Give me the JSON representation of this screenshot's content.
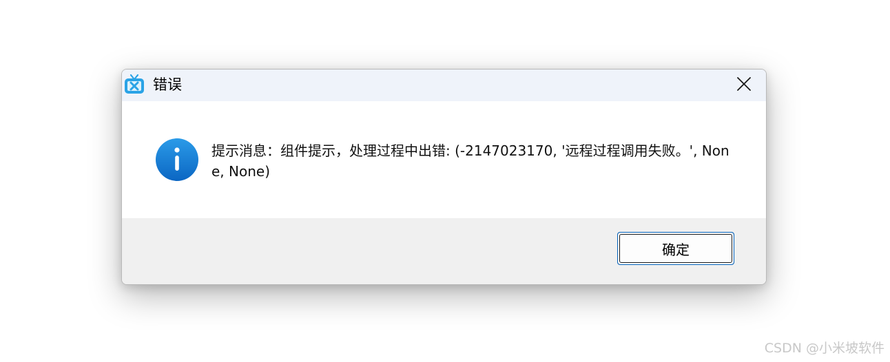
{
  "dialog": {
    "title": "错误",
    "app_icon": "tv-icon",
    "close_icon": "close-icon",
    "message_icon": "info-icon",
    "message": "提示消息：组件提示，处理过程中出错: (-2147023170, '远程过程调用失败。', None, None)",
    "ok_label": "确定"
  },
  "watermark": "CSDN @小米坡软件",
  "colors": {
    "titlebar_bg": "#eff3fa",
    "footer_bg": "#f0f0f0",
    "info_blue": "#1a7fd6",
    "app_icon_blue": "#2aa3e6",
    "button_border": "#005fb8"
  }
}
